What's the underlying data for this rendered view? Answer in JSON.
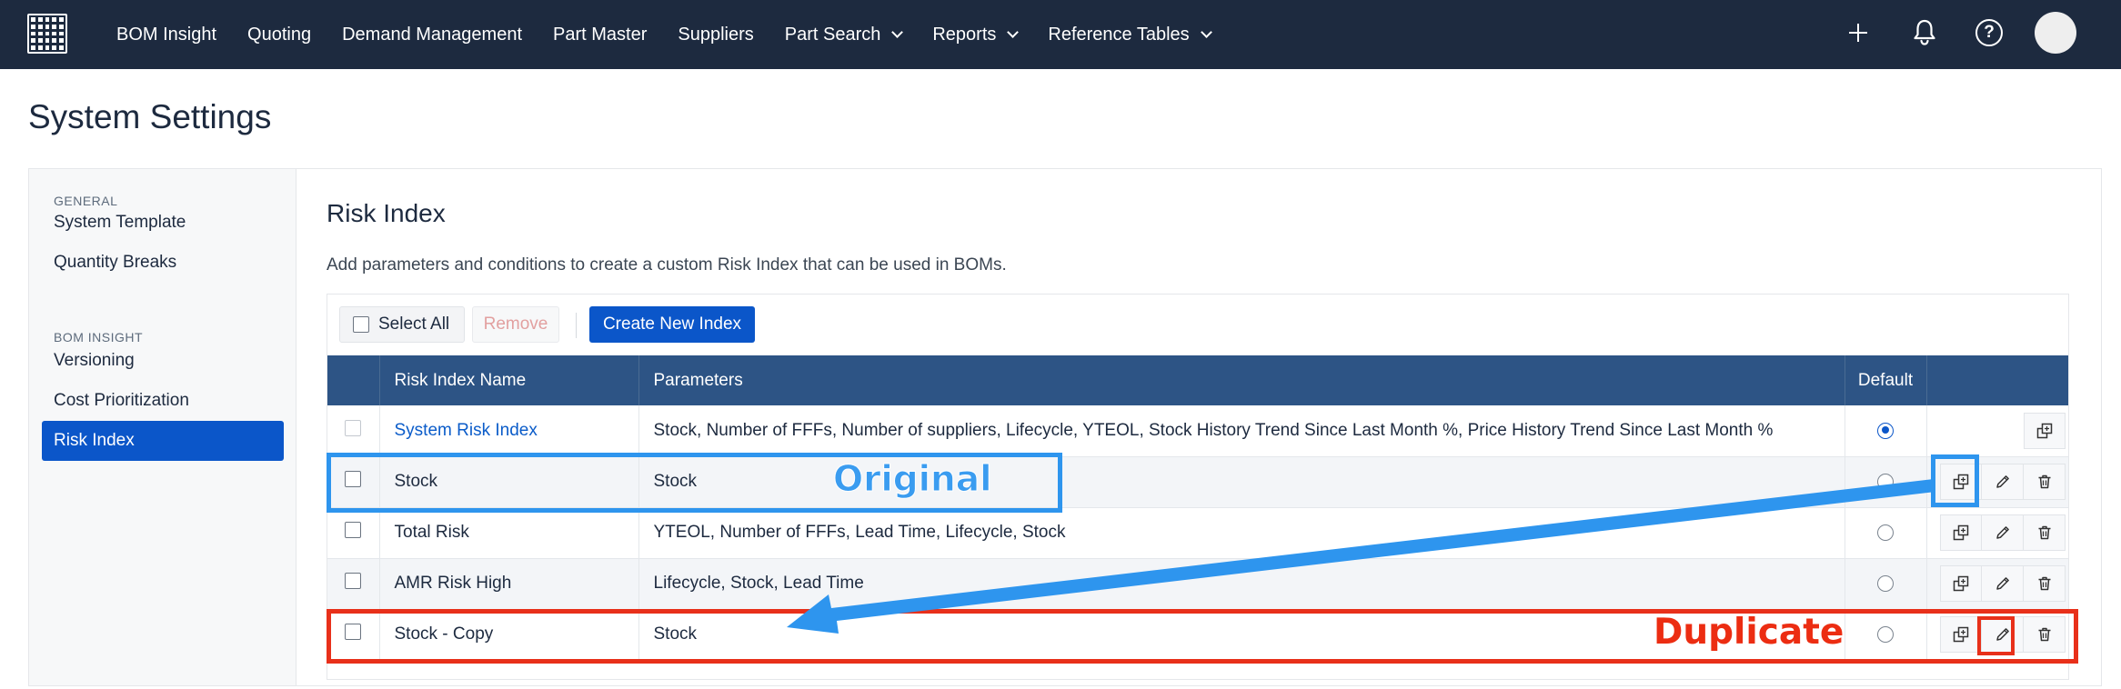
{
  "nav": {
    "items": [
      {
        "label": "BOM Insight",
        "dropdown": false
      },
      {
        "label": "Quoting",
        "dropdown": false
      },
      {
        "label": "Demand Management",
        "dropdown": false
      },
      {
        "label": "Part Master",
        "dropdown": false
      },
      {
        "label": "Suppliers",
        "dropdown": false
      },
      {
        "label": "Part Search",
        "dropdown": true
      },
      {
        "label": "Reports",
        "dropdown": true
      },
      {
        "label": "Reference Tables",
        "dropdown": true
      }
    ],
    "help_glyph": "?"
  },
  "page": {
    "title": "System Settings"
  },
  "sidebar": {
    "general_label": "GENERAL",
    "general_items": [
      "System Template",
      "Quantity Breaks"
    ],
    "bom_label": "BOM INSIGHT",
    "bom_items": [
      "Versioning",
      "Cost Prioritization",
      "Risk Index"
    ],
    "active": "Risk Index"
  },
  "risk_index": {
    "title": "Risk Index",
    "description": "Add parameters and conditions to create a custom Risk Index that can be used in BOMs.",
    "toolbar": {
      "select_all": "Select All",
      "remove": "Remove",
      "create": "Create New Index"
    },
    "columns": {
      "name": "Risk Index Name",
      "parameters": "Parameters",
      "default": "Default"
    },
    "rows": [
      {
        "name": "System Risk Index",
        "parameters": "Stock, Number of FFFs, Number of suppliers, Lifecycle, YTEOL, Stock History Trend Since Last Month %, Price History Trend Since Last Month %",
        "default": true,
        "system": true
      },
      {
        "name": "Stock",
        "parameters": "Stock",
        "default": false,
        "system": false
      },
      {
        "name": "Total Risk",
        "parameters": "YTEOL, Number of FFFs, Lead Time, Lifecycle, Stock",
        "default": false,
        "system": false
      },
      {
        "name": "AMR Risk High",
        "parameters": "Lifecycle, Stock, Lead Time",
        "default": false,
        "system": false
      },
      {
        "name": "Stock - Copy",
        "parameters": "Stock",
        "default": false,
        "system": false
      }
    ]
  },
  "annotations": {
    "original_label": "Original",
    "duplicate_label": "Duplicate",
    "original_color": "#2e95ee",
    "duplicate_color": "#e8301a"
  },
  "icons": {
    "logo": "grid-logo-icon",
    "plus": "plus-icon",
    "bell": "bell-icon",
    "help": "help-icon",
    "duplicate": "duplicate-icon",
    "edit": "edit-icon",
    "delete": "trash-icon"
  },
  "colors": {
    "topbar": "#1d2a3f",
    "accent": "#0b56c9",
    "table_header": "#2d5485",
    "link": "#0b5cc9"
  }
}
